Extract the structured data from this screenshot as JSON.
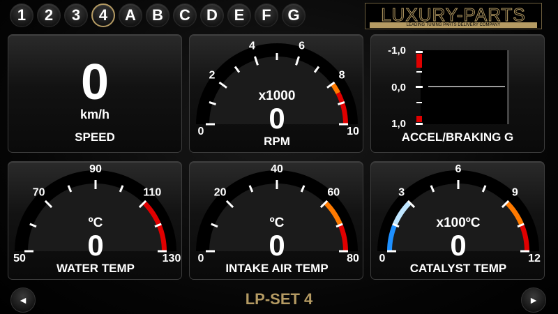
{
  "tabs": [
    {
      "label": "1"
    },
    {
      "label": "2"
    },
    {
      "label": "3"
    },
    {
      "label": "4",
      "active": true
    },
    {
      "label": "A"
    },
    {
      "label": "B"
    },
    {
      "label": "C"
    },
    {
      "label": "D"
    },
    {
      "label": "E"
    },
    {
      "label": "F"
    },
    {
      "label": "G"
    }
  ],
  "logo": {
    "brand": "LUXURY-PARTS",
    "tagline": "LEADING TUNING PARTS DELIVERY COMPANY"
  },
  "speed": {
    "value": "0",
    "unit": "km/h",
    "label": "SPEED"
  },
  "gauges": {
    "rpm": {
      "label": "RPM",
      "unit": "x1000",
      "value": "0",
      "ticks": [
        {
          "v": 0,
          "t": "0"
        },
        {
          "v": 2,
          "t": "2"
        },
        {
          "v": 4,
          "t": "4"
        },
        {
          "v": 6,
          "t": "6"
        },
        {
          "v": 8,
          "t": "8"
        },
        {
          "v": 10,
          "t": "10"
        }
      ],
      "min": 0,
      "max": 10,
      "orange": [
        8,
        8.5
      ],
      "red": [
        8.5,
        10
      ]
    },
    "water": {
      "label": "WATER TEMP",
      "unit": "ºC",
      "value": "0",
      "ticks": [
        {
          "v": 50,
          "t": "50"
        },
        {
          "v": 70,
          "t": "70"
        },
        {
          "v": 90,
          "t": "90"
        },
        {
          "v": 110,
          "t": "110"
        },
        {
          "v": 130,
          "t": "130"
        }
      ],
      "min": 50,
      "max": 130,
      "red": [
        110,
        130
      ]
    },
    "intake": {
      "label": "INTAKE AIR TEMP",
      "unit": "ºC",
      "value": "0",
      "ticks": [
        {
          "v": 0,
          "t": "0"
        },
        {
          "v": 20,
          "t": "20"
        },
        {
          "v": 40,
          "t": "40"
        },
        {
          "v": 60,
          "t": "60"
        },
        {
          "v": 80,
          "t": "80"
        }
      ],
      "min": 0,
      "max": 80,
      "orange": [
        60,
        70
      ],
      "red": [
        70,
        80
      ]
    },
    "catalyst": {
      "label": "CATALYST TEMP",
      "unit": "x100ºC",
      "value": "0",
      "ticks": [
        {
          "v": 0,
          "t": "0"
        },
        {
          "v": 3,
          "t": "3"
        },
        {
          "v": 6,
          "t": "6"
        },
        {
          "v": 9,
          "t": "9"
        },
        {
          "v": 12,
          "t": "12"
        }
      ],
      "min": 0,
      "max": 12,
      "blue": [
        0,
        1.5
      ],
      "lightblue": [
        1.5,
        3
      ],
      "orange": [
        9,
        10.5
      ],
      "red": [
        10.5,
        12
      ]
    }
  },
  "accel": {
    "label": "ACCEL/BRAKING G",
    "ticks": [
      "-1,0",
      "0,0",
      "1,0"
    ],
    "value": 0
  },
  "bottom": {
    "set_label": "LP-SET 4",
    "prev_icon": "◄",
    "next_icon": "►"
  },
  "colors": {
    "accent": "#b59b63",
    "red": "#e00000",
    "orange": "#ff7a00",
    "blue": "#1e90ff",
    "lightblue": "#bfe6ff"
  }
}
